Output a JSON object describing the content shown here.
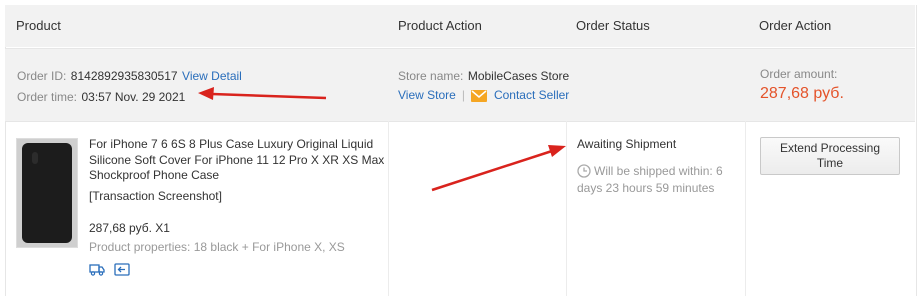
{
  "header": {
    "product": "Product",
    "product_action": "Product Action",
    "order_status": "Order Status",
    "order_action": "Order Action"
  },
  "order": {
    "id_label": "Order ID:",
    "id_value": "8142892935830517",
    "view_detail": "View Detail",
    "time_label": "Order time:",
    "time_value": "03:57 Nov. 29 2021",
    "store_label": "Store name:",
    "store_value": "MobileCases Store",
    "view_store": "View Store",
    "separator": "|",
    "contact_seller": "Contact Seller",
    "amount_label": "Order amount:",
    "amount_value": "287,68 руб."
  },
  "item": {
    "title": "For iPhone 7 6 6S 8 Plus Case Luxury Original Liquid Silicone Soft Cover For iPhone 11 12 Pro X XR XS Max Shockproof Phone Case",
    "screenshot": "[Transaction Screenshot]",
    "price": "287,68 руб. X1",
    "properties": "Product properties: 18 black + For iPhone X, XS"
  },
  "status": {
    "text": "Awaiting Shipment",
    "ship_line1": "Will be shipped within: 6",
    "ship_line2": "days 23 hours 59 minutes"
  },
  "action": {
    "extend_line1": "Extend Processing",
    "extend_line2": "Time"
  },
  "icons": {
    "truck": "truck-icon",
    "return": "return-icon",
    "envelope": "envelope-icon",
    "clock": "clock-icon"
  },
  "colors": {
    "link": "#2a6ebb",
    "price": "#e4532a",
    "arrow": "#d9231d"
  }
}
